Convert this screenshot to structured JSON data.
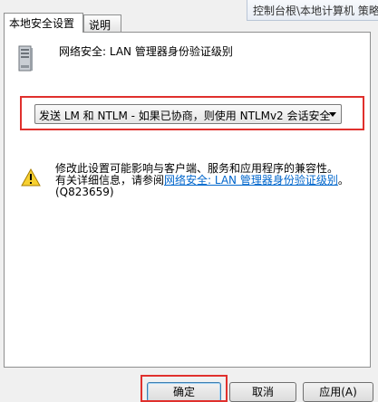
{
  "background_window": {
    "breadcrumb": "控制台根\\本地计算机 策略"
  },
  "tabs": [
    {
      "label": "本地安全设置"
    },
    {
      "label": "说明"
    }
  ],
  "policy": {
    "title": "网络安全: LAN 管理器身份验证级别",
    "icon": "server-icon"
  },
  "dropdown": {
    "selected": "发送 LM 和 NTLM - 如果已协商，则使用 NTLMv2 会话安全"
  },
  "warning": {
    "line1": "修改此设置可能影响与客户端、服务和应用程序的兼容性。",
    "line2_prefix": "有关详细信息，请参阅",
    "link": "网络安全: LAN 管理器身份验证级别",
    "line2_suffix": "。",
    "kb": "(Q823659)",
    "icon": "warning-icon"
  },
  "buttons": {
    "ok": "确定",
    "cancel": "取消",
    "apply": "应用(A)"
  },
  "colors": {
    "highlight_box": "#e0302d",
    "link": "#0066cc"
  }
}
